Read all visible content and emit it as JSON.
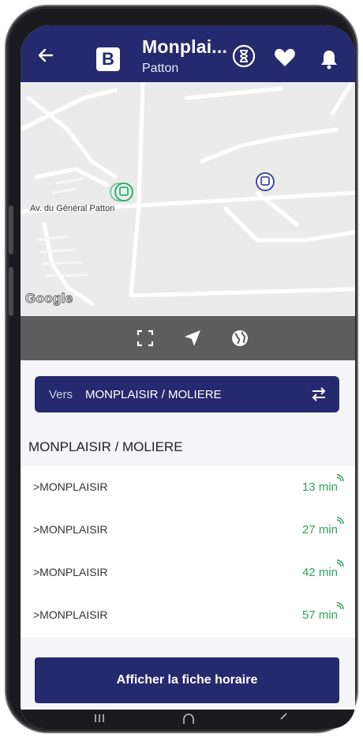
{
  "header": {
    "title": "Monplai...",
    "subtitle": "Patton",
    "logo_letter": "B",
    "bg_color": "#252a6e"
  },
  "map": {
    "street_label": "Av. du Général Patton",
    "attribution": "Google"
  },
  "direction": {
    "prefix": "Vers",
    "destination": "MONPLAISIR / MOLIERE"
  },
  "stop": {
    "name": "MONPLAISIR / MOLIERE"
  },
  "departures": [
    {
      "destination": ">MONPLAISIR",
      "time": "13 min"
    },
    {
      "destination": ">MONPLAISIR",
      "time": "27 min"
    },
    {
      "destination": ">MONPLAISIR",
      "time": "42 min"
    },
    {
      "destination": ">MONPLAISIR",
      "time": "57 min"
    }
  ],
  "actions": {
    "timetable_label": "Afficher la fiche horaire"
  },
  "colors": {
    "accent": "#252a6e",
    "realtime": "#2fa35a",
    "toolbar": "#5d5d5d"
  }
}
